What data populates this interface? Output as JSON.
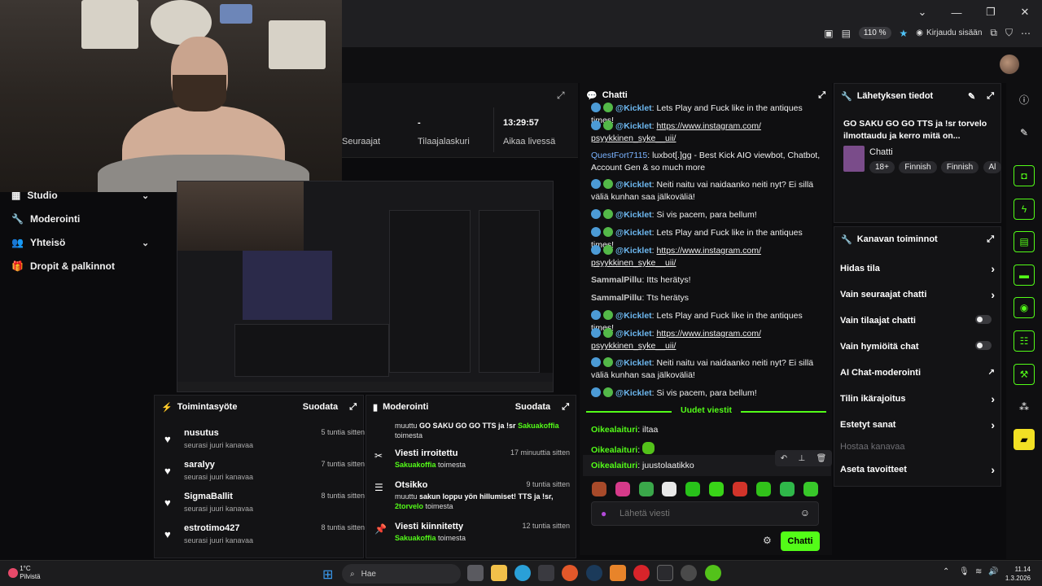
{
  "browser": {
    "zoom": "110 %",
    "login_label": "Kirjaudu sisään"
  },
  "stats": {
    "followers_label": "Seuraajat",
    "subs_value": "-",
    "subs_label": "Tilaajalaskuri",
    "live_time_value": "13:29:57",
    "live_time_label": "Aikaa livessä"
  },
  "nav": {
    "studio": "Studio",
    "moderation": "Moderointi",
    "community": "Yhteisö",
    "drops": "Dropit & palkinnot"
  },
  "activity": {
    "title": "Toimintasyöte",
    "filter": "Suodata",
    "items": [
      {
        "name": "nusutus",
        "sub": "seurasi juuri kanavaa",
        "time": "5 tuntia sitten"
      },
      {
        "name": "saralyy",
        "sub": "seurasi juuri kanavaa",
        "time": "7 tuntia sitten"
      },
      {
        "name": "SigmaBallit",
        "sub": "seurasi juuri kanavaa",
        "time": "8 tuntia sitten"
      },
      {
        "name": "estrotimo427",
        "sub": "seurasi juuri kanavaa",
        "time": "8 tuntia sitten"
      }
    ]
  },
  "moderation": {
    "title": "Moderointi",
    "filter": "Suodata",
    "top": {
      "text_a": "muuttu",
      "text_b": "GO SAKU GO GO TTS ja !sr",
      "user": "Sakuakoffia",
      "suffix": "toimesta"
    },
    "items": [
      {
        "title": "Viesti irroitettu",
        "time": "17 minuuttia sitten",
        "user": "Sakuakoffia",
        "suffix": "toimesta"
      },
      {
        "title": "Otsikko",
        "time": "9 tuntia sitten",
        "text_a": "muuttu",
        "text_b": "sakun loppu yön hillumiset! TTS ja !sr,",
        "user": "2torvelo",
        "suffix": "toimesta"
      },
      {
        "title": "Viesti kiinnitetty",
        "time": "12 tuntia sitten",
        "user": "Sakuakoffia",
        "suffix": "toimesta"
      }
    ]
  },
  "chat": {
    "title": "Chatti",
    "messages": [
      {
        "user": "@Kicklet",
        "text": "Lets Play and Fuck like in the antiques times!"
      },
      {
        "user": "@Kicklet",
        "text": "https://www.instagram.com/ psyykkinen_syke__uii/"
      },
      {
        "user": "QuestFort7115",
        "text": "luxbot[.]gg - Best Kick AIO viewbot, Chatbot, Account Gen & so much more"
      },
      {
        "user": "@Kicklet",
        "text": "Neiti naitu vai naidaanko neiti nyt? Ei sillä väliä kunhan saa jälkoväliä!"
      },
      {
        "user": "@Kicklet",
        "text": "Si vis pacem, para bellum!"
      },
      {
        "user": "@Kicklet",
        "text": "Lets Play and Fuck like in the antiques times!"
      },
      {
        "user": "@Kicklet",
        "text": "https://www.instagram.com/ psyykkinen_syke__uii/"
      },
      {
        "user": "SammalPillu",
        "text": "Itts herätys!"
      },
      {
        "user": "SammalPillu",
        "text": "Tts herätys"
      },
      {
        "user": "@Kicklet",
        "text": "Lets Play and Fuck like in the antiques times!"
      },
      {
        "user": "@Kicklet",
        "text": "https://www.instagram.com/ psyykkinen_syke__uii/"
      },
      {
        "user": "@Kicklet",
        "text": "Neiti naitu vai naidaanko neiti nyt? Ei sillä väliä kunhan saa jälkoväliä!"
      },
      {
        "user": "@Kicklet",
        "text": "Si vis pacem, para bellum!"
      }
    ],
    "new_messages": "Uudet viestit",
    "new": [
      {
        "user": "Oikealaituri",
        "text": "iltaa"
      },
      {
        "user": "Oikealaituri",
        "text": ""
      },
      {
        "user": "Oikealaituri",
        "text": "juustolaatikko"
      }
    ],
    "input_placeholder": "Lähetä viesti",
    "send": "Chatti"
  },
  "stream_info": {
    "title": "Lähetyksen tiedot",
    "stream_title": "GO SAKU GO GO TTS ja !sr torvelo ilmottaudu ja kerro mitä on...",
    "category": "Chatti",
    "tags": [
      "18+",
      "Finnish",
      "Finnish",
      "Al"
    ]
  },
  "channel_actions": {
    "title": "Kanavan toiminnot",
    "items": [
      {
        "label": "Hidas tila",
        "kind": "arrow"
      },
      {
        "label": "Vain seuraajat chatti",
        "kind": "arrow"
      },
      {
        "label": "Vain tilaajat chatti",
        "kind": "toggle"
      },
      {
        "label": "Vain hymiöitä chat",
        "kind": "toggle"
      },
      {
        "label": "AI Chat-moderointi",
        "kind": "external"
      },
      {
        "label": "Tilin ikärajoitus",
        "kind": "arrow"
      },
      {
        "label": "Estetyt sanat",
        "kind": "arrow"
      },
      {
        "label": "Hostaa kanavaa",
        "kind": "disabled"
      },
      {
        "label": "Aseta tavoitteet",
        "kind": "arrow"
      }
    ]
  },
  "taskbar": {
    "temp": "1°C",
    "weather": "Pilvistä",
    "search": "Hae",
    "time": "11.14",
    "date": "1.3.2026"
  }
}
